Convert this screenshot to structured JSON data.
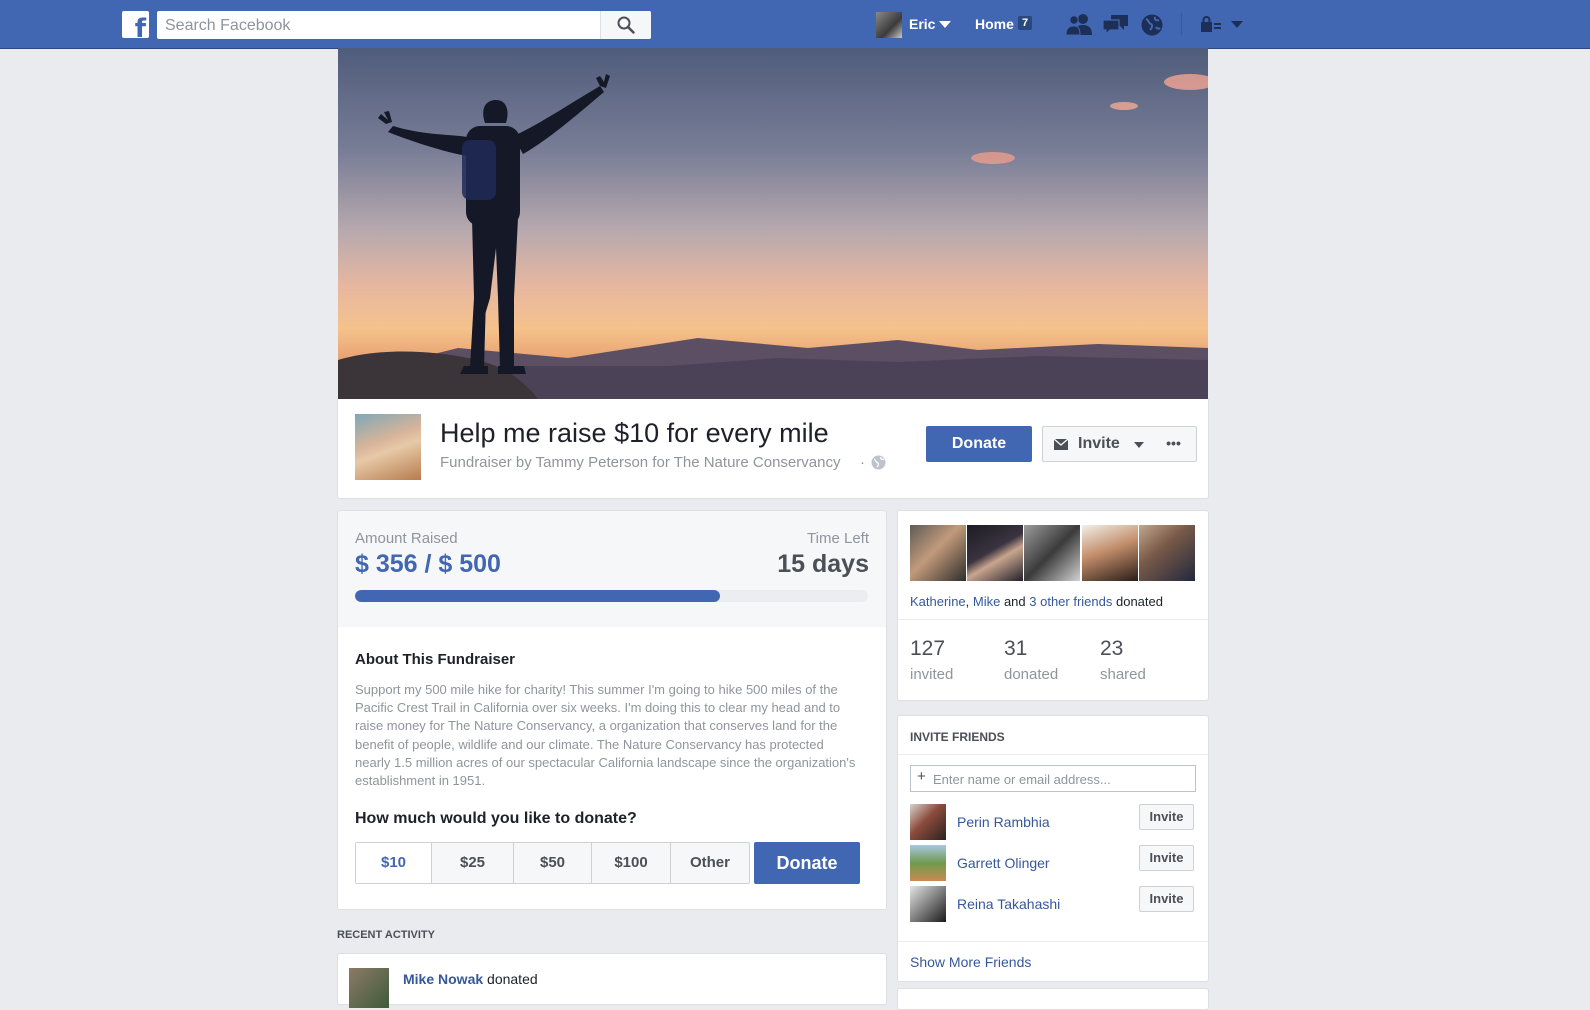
{
  "nav": {
    "search_placeholder": "Search Facebook",
    "user_name": "Eric",
    "home_label": "Home",
    "home_count": "7"
  },
  "fundraiser": {
    "title": "Help me raise $10 for every mile",
    "subtitle": "Fundraiser by Tammy Peterson for The Nature Conservancy",
    "donate_label": "Donate",
    "invite_label": "Invite",
    "more_label": "•••"
  },
  "stats": {
    "amount_label": "Amount Raised",
    "amount_value": "$ 356 / $ 500",
    "time_label": "Time Left",
    "time_value": "15 days",
    "progress_raised": 356,
    "progress_goal": 500
  },
  "about": {
    "heading": "About This Fundraiser",
    "body": "Support my 500 mile hike for charity! This summer I'm going to hike 500 miles of the Pacific Crest Trail in California over six weeks. I'm doing this to clear my head and to raise money for The Nature Conservancy, a organization that conserves land for the benefit of people, wildlife and our climate. The Nature Conservancy has protected nearly 1.5 million acres of our spectacular California landscape since the organization's establishment in 1951.",
    "donate_question": "How much would you like to donate?",
    "amounts": [
      "$10",
      "$25",
      "$50",
      "$100",
      "Other"
    ],
    "selected_amount": "$10",
    "donate_button": "Donate"
  },
  "recent": {
    "heading": "RECENT ACTIVITY",
    "items": [
      {
        "name": "Mike Nowak",
        "action": "donated"
      }
    ]
  },
  "friends": {
    "friend1": "Katherine",
    "sep1": ", ",
    "friend2": "Mike",
    "and": " and ",
    "others": "3 other friends",
    "action": " donated",
    "invited_count": "127",
    "invited_label": "invited",
    "donated_count": "31",
    "donated_label": "donated",
    "shared_count": "23",
    "shared_label": "shared"
  },
  "invite_friends": {
    "heading": "INVITE FRIENDS",
    "input_placeholder": "Enter name or email address...",
    "people": [
      {
        "name": "Perin Rambhia",
        "button": "Invite"
      },
      {
        "name": "Garrett Olinger",
        "button": "Invite"
      },
      {
        "name": "Reina Takahashi",
        "button": "Invite"
      }
    ],
    "show_more": "Show More Friends"
  },
  "colors": {
    "brand": "#4267b2",
    "link": "#365899",
    "page_bg": "#e9ebee"
  },
  "icons": [
    "facebook-logo-icon",
    "search-icon",
    "caret-down-icon",
    "friend-requests-icon",
    "messages-icon",
    "notifications-globe-icon",
    "privacy-lock-icon",
    "envelope-icon",
    "globe-icon",
    "plus-icon"
  ]
}
